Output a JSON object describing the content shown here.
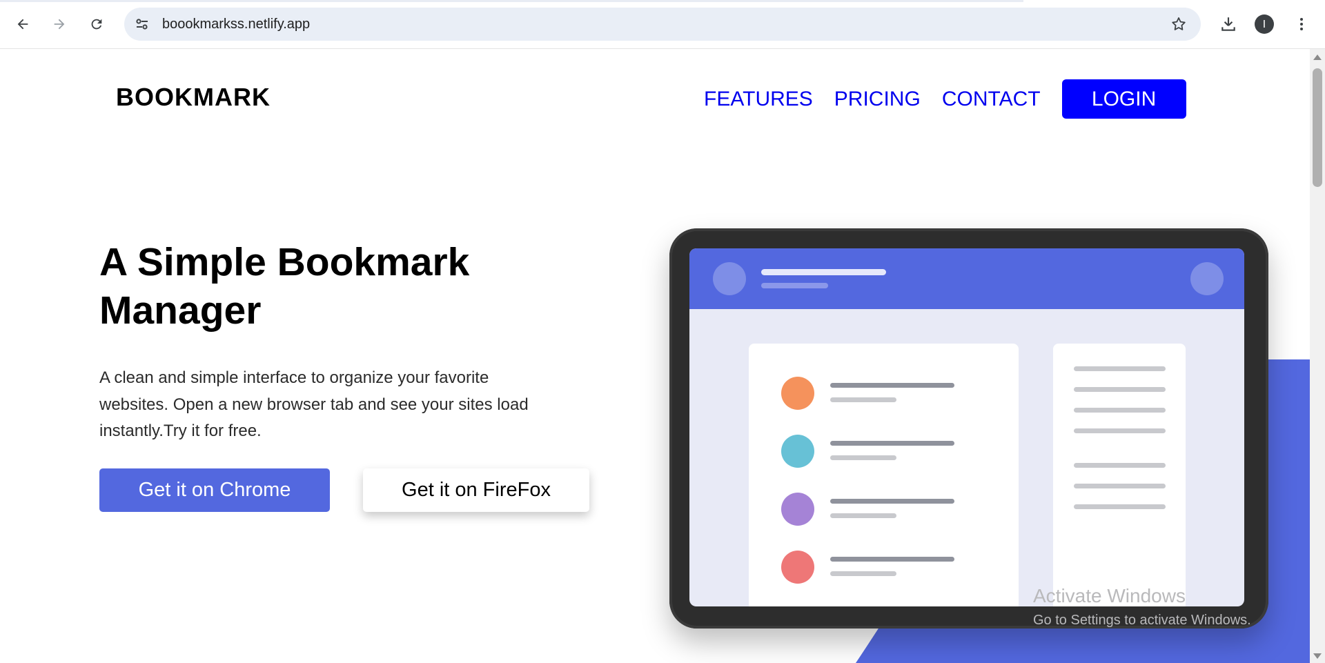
{
  "browser": {
    "url": "boookmarkss.netlify.app",
    "profile_initial": "I",
    "icons": {
      "back": "back-arrow-icon",
      "forward": "forward-arrow-icon",
      "reload": "reload-icon",
      "site_info": "tune-icon",
      "bookmark": "star-icon",
      "downloads": "download-icon",
      "menu": "kebab-menu-icon"
    }
  },
  "site": {
    "logo": "BOOKMARK",
    "nav": {
      "features": "FEATURES",
      "pricing": "PRICING",
      "contact": "CONTACT",
      "login": "LOGIN"
    },
    "hero": {
      "title": "A Simple Bookmark Manager",
      "description": "A clean and simple interface to organize your favorite websites. Open a new browser tab and see your sites load instantly.Try it for free.",
      "cta_chrome": "Get it on Chrome",
      "cta_firefox": "Get it on FireFox"
    }
  },
  "watermark": {
    "line1": "Activate Windows",
    "line2": "Go to Settings to activate Windows."
  },
  "colors": {
    "accent": "#5368df",
    "nav_link": "#0000ee",
    "login_bg": "#0000ff",
    "dot_orange": "#f5925c",
    "dot_teal": "#67c1d6",
    "dot_purple": "#a583d6",
    "dot_red": "#ee7777"
  }
}
